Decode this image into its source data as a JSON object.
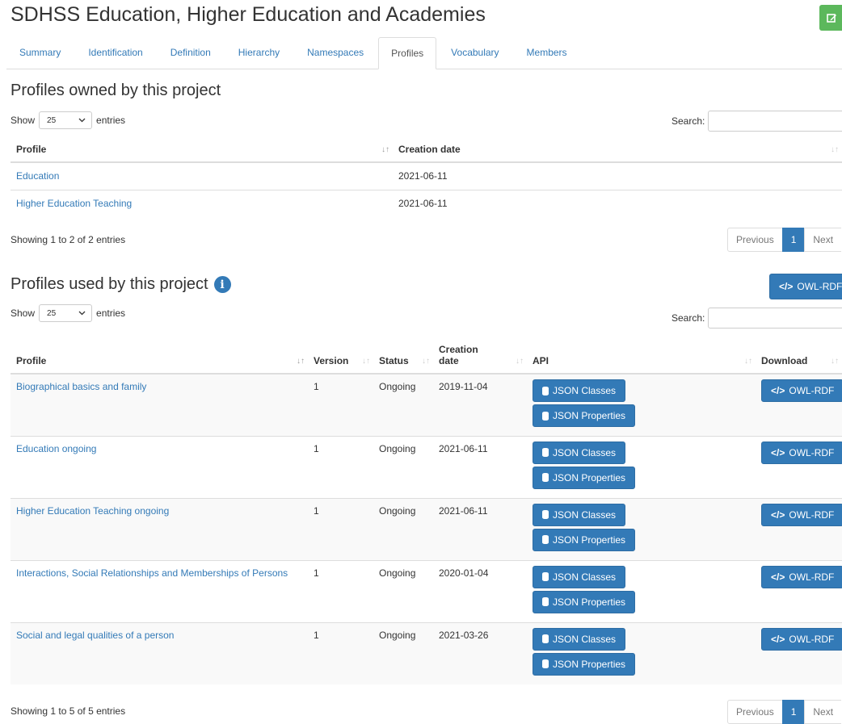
{
  "page": {
    "title": "SDHSS Education, Higher Education and Academies"
  },
  "tabs": [
    {
      "label": "Summary"
    },
    {
      "label": "Identification"
    },
    {
      "label": "Definition"
    },
    {
      "label": "Hierarchy"
    },
    {
      "label": "Namespaces"
    },
    {
      "label": "Profiles"
    },
    {
      "label": "Vocabulary"
    },
    {
      "label": "Members"
    }
  ],
  "owned": {
    "title": "Profiles owned by this project",
    "show_label": "Show",
    "length_value": "25",
    "entries_label": "entries",
    "search_label": "Search:",
    "columns": [
      "Profile",
      "Creation date"
    ],
    "rows": [
      {
        "profile": "Education",
        "date": "2021-06-11"
      },
      {
        "profile": "Higher Education Teaching",
        "date": "2021-06-11"
      }
    ],
    "info": "Showing 1 to 2 of 2 entries",
    "pager": {
      "previous": "Previous",
      "current": "1",
      "next": "Next"
    }
  },
  "used": {
    "title": "Profiles used by this project",
    "owl_button": "OWL-RDF",
    "show_label": "Show",
    "length_value": "25",
    "entries_label": "entries",
    "search_label": "Search:",
    "columns": {
      "profile": "Profile",
      "version": "Version",
      "status": "Status",
      "creation_1": "Creation",
      "creation_2": "date",
      "api": "API",
      "download": "Download"
    },
    "buttons": {
      "json_classes": "JSON Classes",
      "json_properties": "JSON Properties",
      "owl": "OWL-RDF"
    },
    "rows": [
      {
        "profile": "Biographical basics and family",
        "version": "1",
        "status": "Ongoing",
        "date": "2019-11-04"
      },
      {
        "profile": "Education ongoing",
        "version": "1",
        "status": "Ongoing",
        "date": "2021-06-11"
      },
      {
        "profile": "Higher Education Teaching ongoing",
        "version": "1",
        "status": "Ongoing",
        "date": "2021-06-11"
      },
      {
        "profile": "Interactions, Social Relationships and Memberships of Persons",
        "version": "1",
        "status": "Ongoing",
        "date": "2020-01-04"
      },
      {
        "profile": "Social and legal qualities of a person",
        "version": "1",
        "status": "Ongoing",
        "date": "2021-03-26"
      }
    ],
    "info": "Showing 1 to 5 of 5 entries",
    "pager": {
      "previous": "Previous",
      "current": "1",
      "next": "Next"
    }
  },
  "colors": {
    "primary": "#337ab7",
    "success": "#5cb85c",
    "border": "#dddddd"
  },
  "icons": [
    "edit-icon",
    "info-icon",
    "code-icon",
    "database-icon",
    "chevron-down-icon",
    "sort-icon"
  ]
}
